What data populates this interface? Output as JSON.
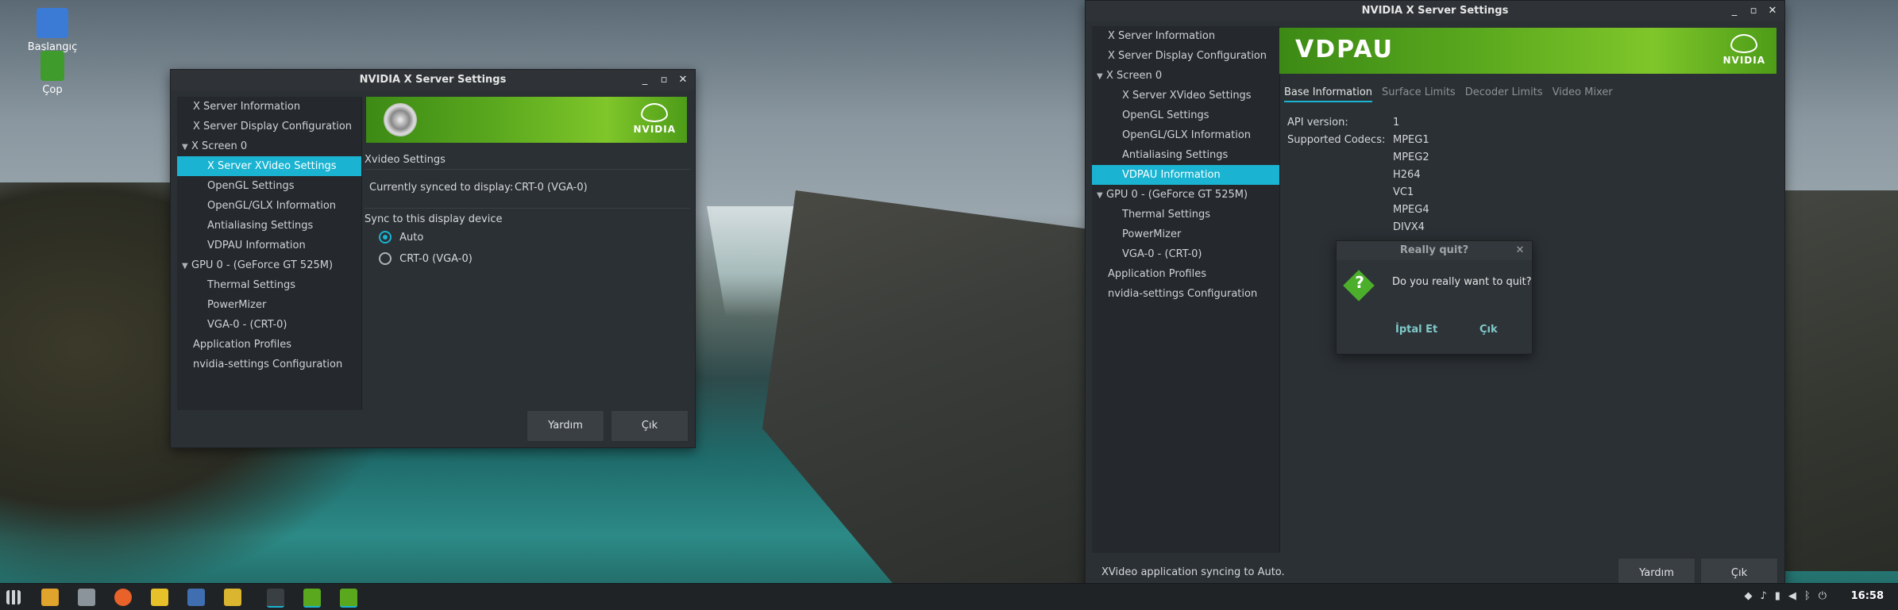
{
  "desktop": {
    "icons": [
      {
        "label": "Başlangıç",
        "icon": "home-folder-icon"
      },
      {
        "label": "Çop",
        "icon": "trash-icon"
      }
    ]
  },
  "window_left": {
    "title": "NVIDIA X Server Settings",
    "tree": [
      {
        "label": "X Server Information",
        "level": 1
      },
      {
        "label": "X Server Display Configuration",
        "level": 1
      },
      {
        "label": "X Screen 0",
        "level": 0
      },
      {
        "label": "X Server XVideo Settings",
        "level": 2,
        "selected": true
      },
      {
        "label": "OpenGL Settings",
        "level": 2
      },
      {
        "label": "OpenGL/GLX Information",
        "level": 2
      },
      {
        "label": "Antialiasing Settings",
        "level": 2
      },
      {
        "label": "VDPAU Information",
        "level": 2
      },
      {
        "label": "GPU 0 - (GeForce GT 525M)",
        "level": 0
      },
      {
        "label": "Thermal Settings",
        "level": 2
      },
      {
        "label": "PowerMizer",
        "level": 2
      },
      {
        "label": "VGA-0 - (CRT-0)",
        "level": 2
      },
      {
        "label": "Application Profiles",
        "level": 1
      },
      {
        "label": "nvidia-settings Configuration",
        "level": 1
      }
    ],
    "banner_logo": "NVIDIA",
    "section_title": "Xvideo Settings",
    "synced_label": "Currently synced to display:",
    "synced_value": "CRT-0 (VGA-0)",
    "sync_device_label": "Sync to this display device",
    "options": [
      {
        "label": "Auto",
        "checked": true
      },
      {
        "label": "CRT-0 (VGA-0)",
        "checked": false
      }
    ],
    "help_button": "Yardım",
    "quit_button": "Çık"
  },
  "window_right": {
    "title": "NVIDIA X Server Settings",
    "tree": [
      {
        "label": "X Server Information",
        "level": 1
      },
      {
        "label": "X Server Display Configuration",
        "level": 1
      },
      {
        "label": "X Screen 0",
        "level": 0
      },
      {
        "label": "X Server XVideo Settings",
        "level": 2
      },
      {
        "label": "OpenGL Settings",
        "level": 2
      },
      {
        "label": "OpenGL/GLX Information",
        "level": 2
      },
      {
        "label": "Antialiasing Settings",
        "level": 2
      },
      {
        "label": "VDPAU Information",
        "level": 2,
        "selected": true
      },
      {
        "label": "GPU 0 - (GeForce GT 525M)",
        "level": 0
      },
      {
        "label": "Thermal Settings",
        "level": 2
      },
      {
        "label": "PowerMizer",
        "level": 2
      },
      {
        "label": "VGA-0 - (CRT-0)",
        "level": 2
      },
      {
        "label": "Application Profiles",
        "level": 1
      },
      {
        "label": "nvidia-settings Configuration",
        "level": 1
      }
    ],
    "banner_text": "VDPAU",
    "banner_logo": "NVIDIA",
    "tabs": [
      "Base Information",
      "Surface Limits",
      "Decoder Limits",
      "Video Mixer"
    ],
    "api_label": "API version:",
    "api_value": "1",
    "codecs_label": "Supported Codecs:",
    "codecs": [
      "MPEG1",
      "MPEG2",
      "H264",
      "VC1",
      "MPEG4",
      "DIVX4"
    ],
    "status_text": "XVideo application syncing to Auto.",
    "help_button": "Yardım",
    "quit_button": "Çık"
  },
  "dialog": {
    "title": "Really quit?",
    "message": "Do you really want to quit?",
    "cancel_button": "İptal Et",
    "ok_button": "Çık"
  },
  "taskbar": {
    "clock": "16:58",
    "accent": "#1ab3d1"
  },
  "colors": {
    "selection": "#1ab3d1",
    "nvidia_green": "#76b900"
  }
}
